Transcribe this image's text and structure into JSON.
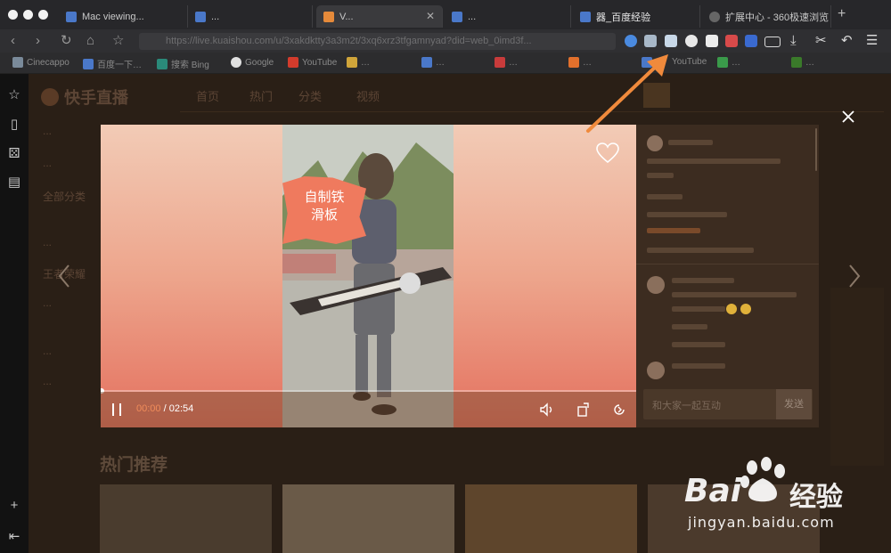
{
  "browser": {
    "tabs": [
      {
        "title": "Mac viewing...",
        "active": false
      },
      {
        "title": "...",
        "active": false
      },
      {
        "title": "V...",
        "active": true
      },
      {
        "title": "...",
        "active": false
      },
      {
        "title": "器_百度经验",
        "active": false
      },
      {
        "title": "扩展中心 - 360极速浏览",
        "active": false
      }
    ],
    "url": "https://live.kuaishou.com/u/3xakdktty3a3m2t/3xq6xrz3tfgamnyad?did=web_0imd3f...",
    "bookmarks": [
      {
        "label": "Cinecappo",
        "color": "#7a8a9a"
      },
      {
        "label": "百度一下…",
        "color": "#4a78c9"
      },
      {
        "label": "搜索 Bing",
        "color": "#2a8a7a"
      },
      {
        "label": "Google",
        "color": "#e0e0e0"
      },
      {
        "label": "YouTube",
        "color": "#d33b2c"
      },
      {
        "label": "…",
        "color": "#d0a53a"
      },
      {
        "label": "…",
        "color": "#4a78c9"
      },
      {
        "label": "…",
        "color": "#c83b3b"
      },
      {
        "label": "…",
        "color": "#e2702c"
      },
      {
        "label": "…",
        "color": "#4a78c9"
      },
      {
        "label": "YouTube",
        "color": "#c8c8c8"
      },
      {
        "label": "…",
        "color": "#3a9a4a"
      },
      {
        "label": "…",
        "color": "#3a7a2a"
      }
    ]
  },
  "page": {
    "site_logo": "快手直播",
    "nav": [
      "首页",
      "热门",
      "分类",
      "视频"
    ],
    "left_list": [
      "...",
      "...",
      "全部分类",
      "...",
      "王者荣耀",
      "...",
      "...",
      "...",
      "热门推荐"
    ],
    "section_title": "热门推荐"
  },
  "player": {
    "overlay_text": "自制铁\n滑板",
    "progress": 0,
    "current_time": "00:00",
    "separator": "/",
    "duration": "02:54"
  },
  "comments": {
    "input_placeholder": "和大家一起互动",
    "send_label": "发送"
  },
  "watermark": {
    "brand": "Bai",
    "brand_cn": "经验",
    "url": "jingyan.baidu.com"
  },
  "colors": {
    "annotation_arrow": "#f08a3c",
    "player_gradient_top": "#f2cbb6",
    "player_gradient_bottom": "#e4715f",
    "time_current": "#f08c5a",
    "badge": "#ef7a5e"
  }
}
